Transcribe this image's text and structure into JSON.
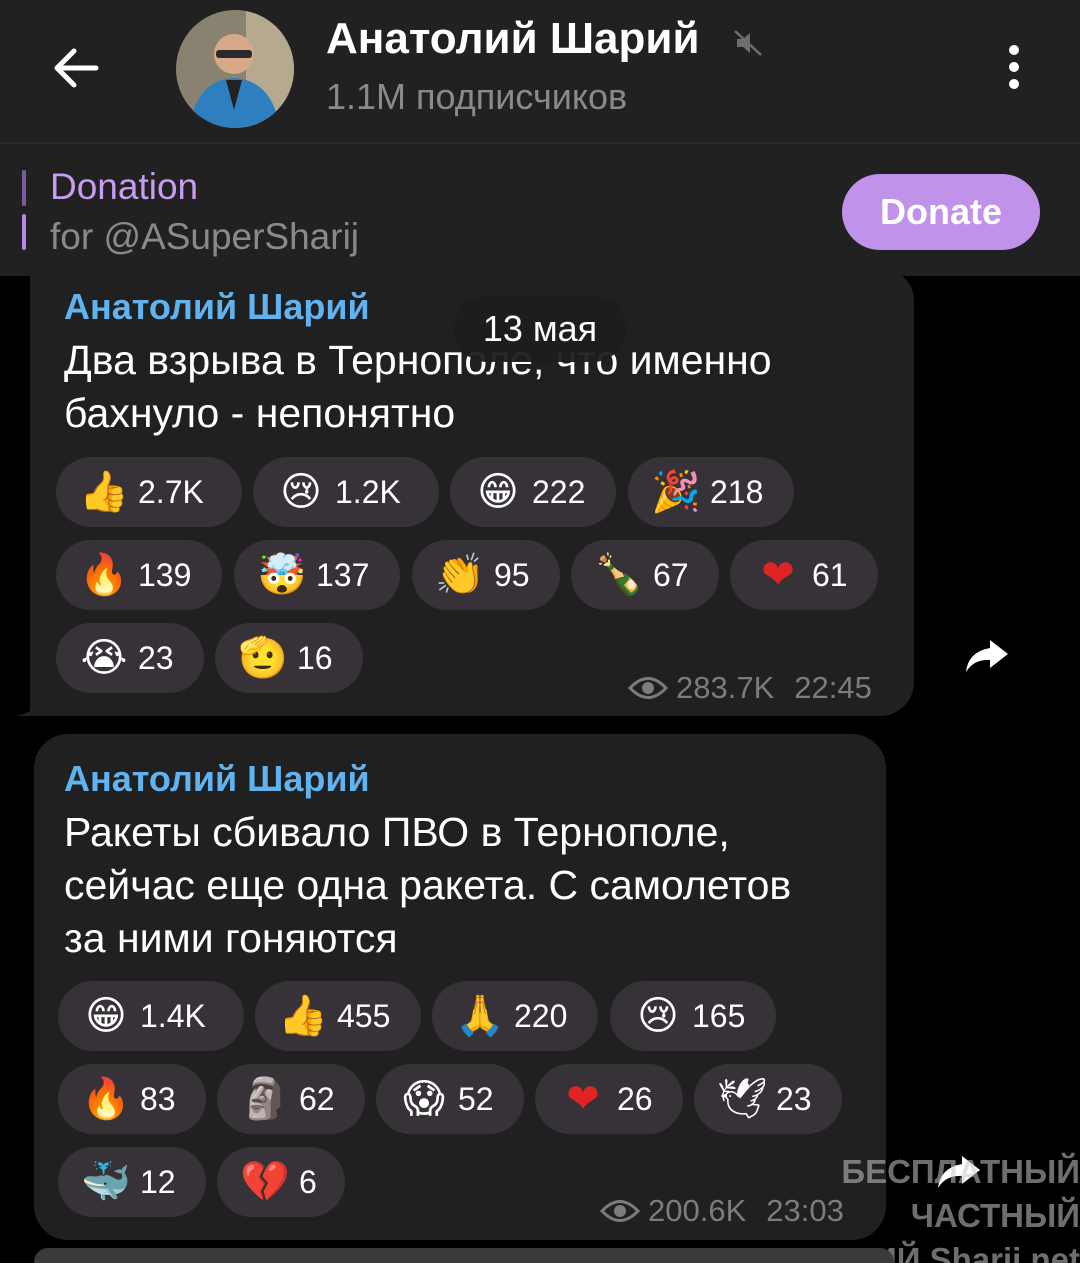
{
  "header": {
    "title": "Анатолий Шарий",
    "subscribers": "1.1M подписчиков",
    "back_icon": "arrow-left-icon",
    "mute_icon": "muted-speaker-icon",
    "menu_icon": "kebab-menu-icon"
  },
  "pinned": {
    "title": "Donation",
    "subtitle": "for @ASuperSharij",
    "button": "Donate",
    "accent": "#c092ea"
  },
  "date_pill": "13 мая",
  "messages": [
    {
      "author": "Анатолий Шарий",
      "lines": [
        "Два взрыва в Тернополе, что именно",
        "бахнуло - непонятно"
      ],
      "reactions": [
        {
          "emoji": "👍",
          "count": "2.7K"
        },
        {
          "emoji": "😢",
          "count": "1.2K"
        },
        {
          "emoji": "😁",
          "count": "222"
        },
        {
          "emoji": "🎉",
          "count": "218"
        },
        {
          "emoji": "🔥",
          "count": "139"
        },
        {
          "emoji": "🤯",
          "count": "137"
        },
        {
          "emoji": "👏",
          "count": "95"
        },
        {
          "emoji": "🍾",
          "count": "67"
        },
        {
          "emoji": "❤",
          "count": "61"
        },
        {
          "emoji": "😭",
          "count": "23"
        },
        {
          "emoji": "🫡",
          "count": "16"
        }
      ],
      "views": "283.7K",
      "time": "22:45"
    },
    {
      "author": "Анатолий Шарий",
      "lines": [
        "Ракеты сбивало ПВО в Тернополе,",
        "сейчас еще одна ракета. С самолетов",
        "за ними гоняются"
      ],
      "reactions": [
        {
          "emoji": "😁",
          "count": "1.4K"
        },
        {
          "emoji": "👍",
          "count": "455"
        },
        {
          "emoji": "🙏",
          "count": "220"
        },
        {
          "emoji": "😢",
          "count": "165"
        },
        {
          "emoji": "🔥",
          "count": "83"
        },
        {
          "emoji": "🗿",
          "count": "62"
        },
        {
          "emoji": "😱",
          "count": "52"
        },
        {
          "emoji": "❤",
          "count": "26"
        },
        {
          "emoji": "🕊",
          "count": "23"
        },
        {
          "emoji": "🐳",
          "count": "12"
        },
        {
          "emoji": "💔",
          "count": "6"
        }
      ],
      "views": "200.6K",
      "time": "23:03"
    }
  ],
  "watermark": {
    "line1": "БЕСПЛАТНЫЙ ЧАСТНЫЙ",
    "line2": "ШАРИЙ Sharij.net"
  }
}
